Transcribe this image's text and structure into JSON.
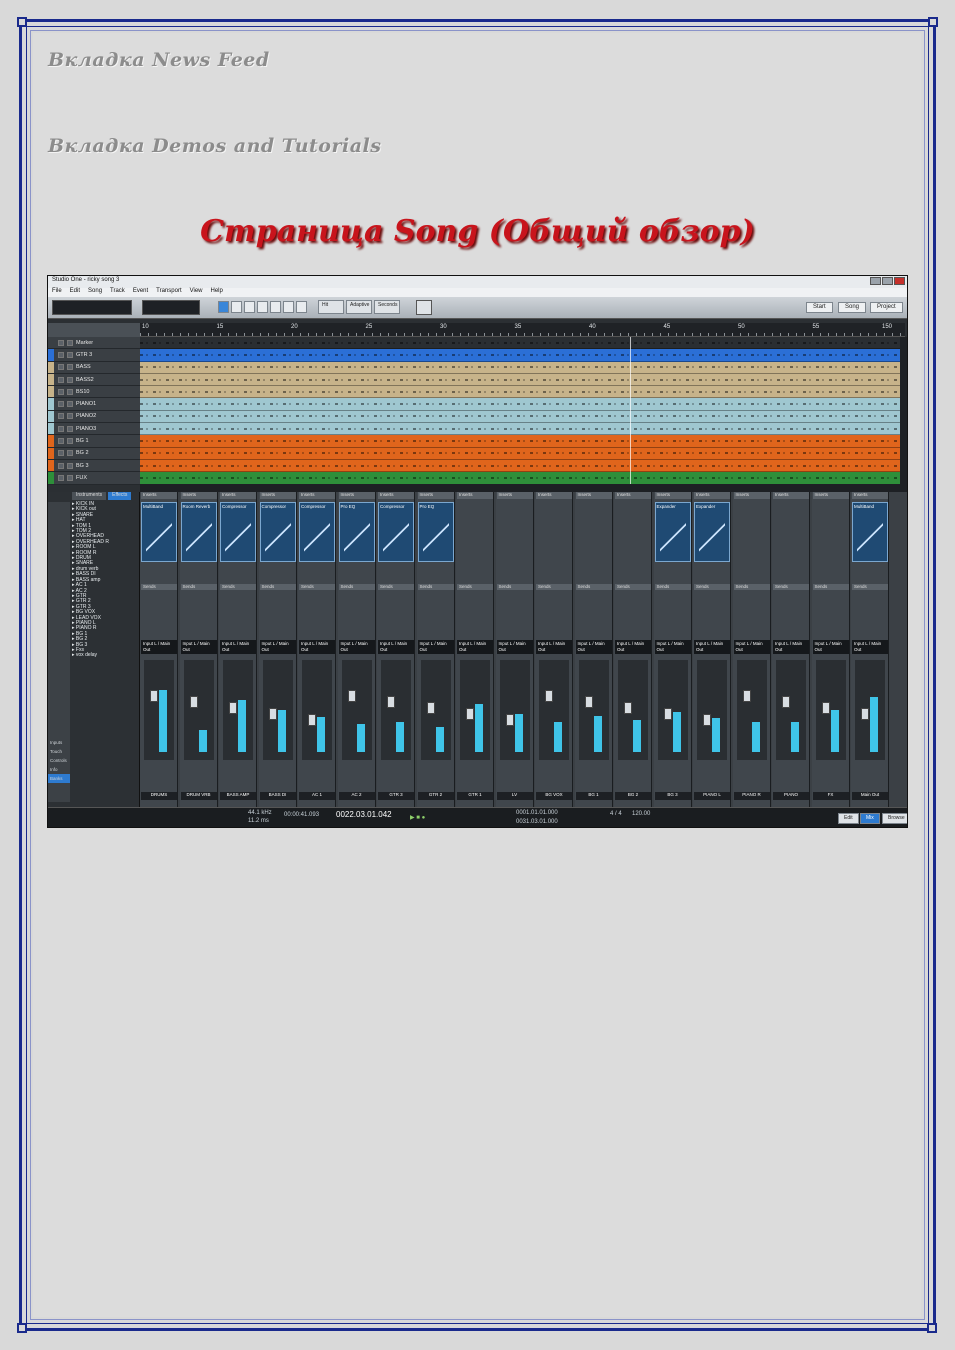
{
  "headings": {
    "news_feed": "Вкладка News Feed",
    "demos": "Вкладка Demos and Tutorials",
    "main_title": "Страница Song (Общий обзор)"
  },
  "screenshot": {
    "title": "Studio One - ricky song 3",
    "menu": [
      "File",
      "Edit",
      "Song",
      "Track",
      "Event",
      "Transport",
      "View",
      "Help"
    ],
    "toolbar_groups": [
      "Hit",
      "Adaptive",
      "Seconds"
    ],
    "toolbar_right": [
      "Start",
      "Song",
      "Project"
    ],
    "ruler": [
      "10",
      "15",
      "20",
      "25",
      "30",
      "35",
      "40",
      "45",
      "50",
      "55",
      "150"
    ],
    "tracks": [
      {
        "name": "Marker",
        "color": "#3a3f44"
      },
      {
        "name": "GTR 3",
        "color": "#2b6fd6"
      },
      {
        "name": "BASS",
        "color": "#c7b38a"
      },
      {
        "name": "BASS2",
        "color": "#c7b38a"
      },
      {
        "name": "BS10",
        "color": "#c7b38a"
      },
      {
        "name": "PIANO1",
        "color": "#9fc7d0"
      },
      {
        "name": "PIANO2",
        "color": "#9fc7d0"
      },
      {
        "name": "PIANO3",
        "color": "#9fc7d0"
      },
      {
        "name": "BG 1",
        "color": "#e0651c"
      },
      {
        "name": "BG 2",
        "color": "#e0651c"
      },
      {
        "name": "BG 3",
        "color": "#e0651c"
      },
      {
        "name": "FUX",
        "color": "#2e8f3a"
      }
    ],
    "browser_tabs": [
      "Instruments",
      "Effects"
    ],
    "browser_items": [
      "KICK IN",
      "KICK out",
      "SNARE",
      "HAT",
      "TOM 1",
      "TOM 2",
      "OVERHEAD",
      "OVERHEAD R",
      "ROOM L",
      "ROOM R",
      "DRUM",
      "SNARE",
      "drum verb",
      "BASS DI",
      "BASS amp",
      "AC 1",
      "AC 2",
      "GTR",
      "GTR 2",
      "GTR 3",
      "BG VOX",
      "LEAD VOX",
      "PIANO L",
      "PIANO R",
      "BG 1",
      "BG 2",
      "BG 3",
      "Fxs",
      "vox delay"
    ],
    "browser_side": [
      "Inputs",
      "Touch",
      "Controls",
      "Info",
      "Banks"
    ],
    "strip_labels": [
      "DRUMS",
      "DRUM VRB",
      "BASS AMP",
      "BASS DI",
      "AC 1",
      "AC 2",
      "GTR 3",
      "GTR 2",
      "GTR 1",
      "LV",
      "BG VOX",
      "BG 1",
      "BG 2",
      "BG 3",
      "PIANO L",
      "PIANO R",
      "PIANO",
      "FX",
      "Main Out"
    ],
    "strip_inserts": [
      "MultiBand",
      "Room Reverb",
      "Compressor",
      "Compressor",
      "Compressor",
      "Pro EQ",
      "Compressor",
      "Pro EQ",
      "Inserts",
      "Inserts",
      "Inserts",
      "Inserts",
      "Inserts",
      "Expander",
      "Expander",
      "Inserts",
      "Inserts",
      "Inserts",
      "MultiBand"
    ],
    "strip_io": "Input L / Main Out",
    "transport": {
      "sample_rate": "44.1 kHz",
      "latency": "11.2 ms",
      "time": "00:00:41.093",
      "position": "0022.03.01.042",
      "loop_l": "0001.01.01.000",
      "loop_r": "0031.03.01.000",
      "signature": "4 / 4",
      "tempo": "120.00",
      "buttons": [
        "Edit",
        "Mix",
        "Browse"
      ]
    }
  },
  "meters": [
    0.62,
    0.22,
    0.52,
    0.42,
    0.35,
    0.28,
    0.3,
    0.25,
    0.48,
    0.38,
    0.3,
    0.36,
    0.32,
    0.4,
    0.34,
    0.3,
    0.3,
    0.42,
    0.55
  ]
}
